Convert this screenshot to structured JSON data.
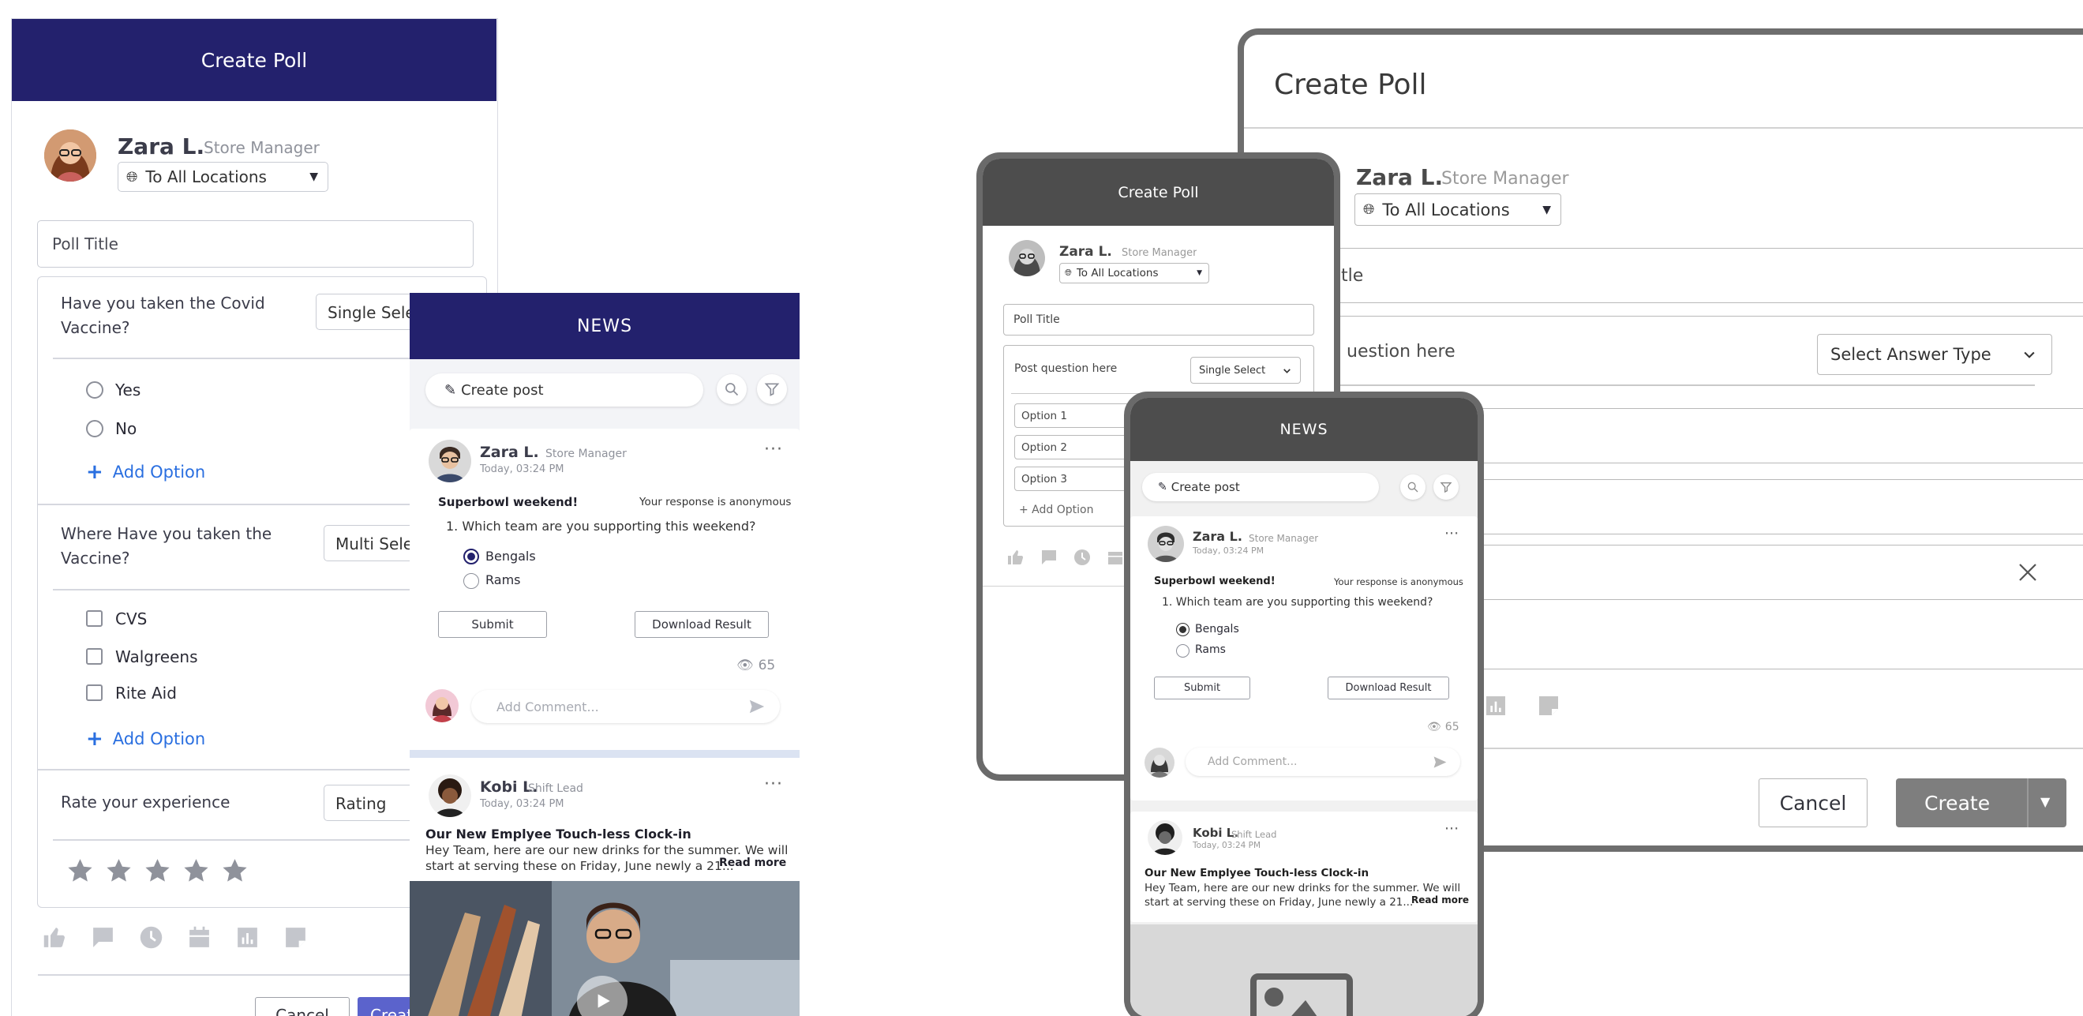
{
  "left_poll": {
    "header_title": "Create Poll",
    "user_name": "Zara L.",
    "user_role": "Store Manager",
    "audience": "To All Locations",
    "poll_title_placeholder": "Poll Title",
    "q1": {
      "line1": "Have you taken the Covid",
      "line2": "Vaccine?",
      "type": "Single Select",
      "options": [
        "Yes",
        "No"
      ],
      "add_option": "Add Option"
    },
    "q2": {
      "line1": "Where Have you taken the",
      "line2": "Vaccine?",
      "type": "Multi Select",
      "options": [
        "CVS",
        "Walgreens",
        "Rite Aid"
      ],
      "add_option": "Add Option"
    },
    "q3": {
      "label": "Rate your experience",
      "type": "Rating",
      "stars": 5
    },
    "cancel_label": "Cancel",
    "create_label": "Create"
  },
  "news": {
    "header_title": "NEWS",
    "create_post": "Create post",
    "post1": {
      "name": "Zara L.",
      "role": "Store Manager",
      "time": "Today, 03:24 PM",
      "title": "Superbowl weekend!",
      "anon": "Your response is anonymous",
      "question": "1. Which team are you supporting this weekend?",
      "options": [
        "Bengals",
        "Rams"
      ],
      "selected": "Bengals",
      "submit": "Submit",
      "download": "Download Result",
      "views": "65",
      "comment_placeholder": "Add Comment..."
    },
    "post2": {
      "name": "Kobi L.",
      "role": "Shift Lead",
      "time": "Today, 03:24 PM",
      "title": "Our New Emplyee Touch-less Clock-in",
      "line1": "Hey Team, here are our new drinks for the summer. We will",
      "line2": "start at serving these on Friday, June newly a 21...",
      "read_more": "Read more"
    }
  },
  "phone_poll": {
    "header_title": "Create Poll",
    "user_name": "Zara L.",
    "user_role": "Store Manager",
    "audience": "To All Locations",
    "poll_title_placeholder": "Poll Title",
    "question_placeholder": "Post question here",
    "type": "Single Select",
    "options": [
      "Option 1",
      "Option 2",
      "Option 3"
    ],
    "add_option": "+ Add Option"
  },
  "desktop_poll": {
    "title": "Create Poll",
    "user_name": "Zara L.",
    "user_role": "Store Manager",
    "audience": "To All Locations",
    "poll_title_fragment": "tle",
    "question_fragment": "uestion here",
    "answer_type": "Select Answer Type",
    "cancel_label": "Cancel",
    "create_label": "Create"
  },
  "colors": {
    "navy": "#23216d",
    "accent_blue": "#2a6fe0",
    "create_button": "#5b63cc",
    "mock_gray": "#4d4d4d"
  }
}
